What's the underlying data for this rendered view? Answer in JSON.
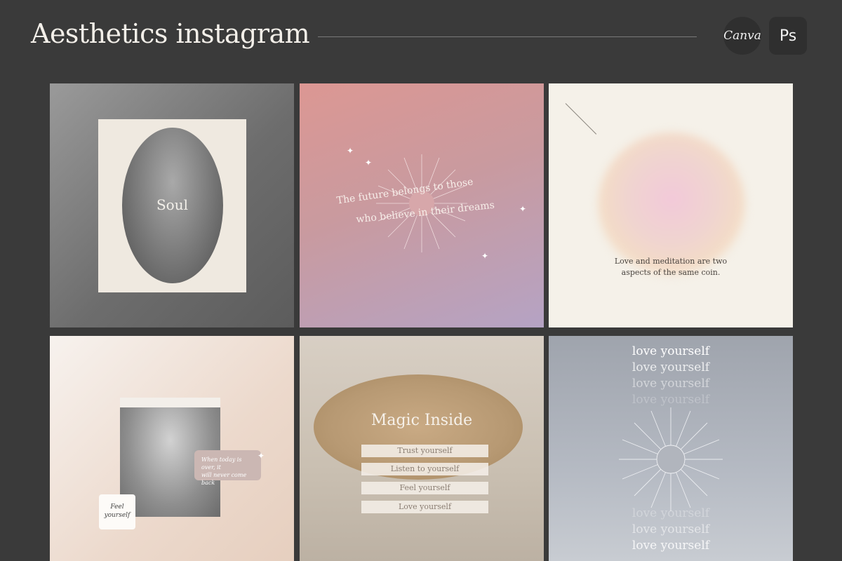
{
  "header": {
    "title": "Aesthetics instagram",
    "badges": {
      "canva": "Canva",
      "ps": "Ps"
    }
  },
  "tiles": {
    "soul": {
      "word": "Soul"
    },
    "future": {
      "line1": "The future belongs to those",
      "line2": "who believe in their dreams"
    },
    "meditation": {
      "line1": "Love and meditation are two",
      "line2": "aspects of the same coin."
    },
    "feel": {
      "bubble_line1": "When today is over, it",
      "bubble_line2": "will never come back",
      "note_line1": "Feel",
      "note_line2": "yourself"
    },
    "magic": {
      "title": "Magic Inside",
      "items": [
        "Trust yourself",
        "Listen to yourself",
        "Feel yourself",
        "Love yourself"
      ]
    },
    "love": {
      "phrase": "love yourself"
    }
  },
  "colors": {
    "background": "#3a3a3a",
    "text_light": "#f3efe9"
  }
}
